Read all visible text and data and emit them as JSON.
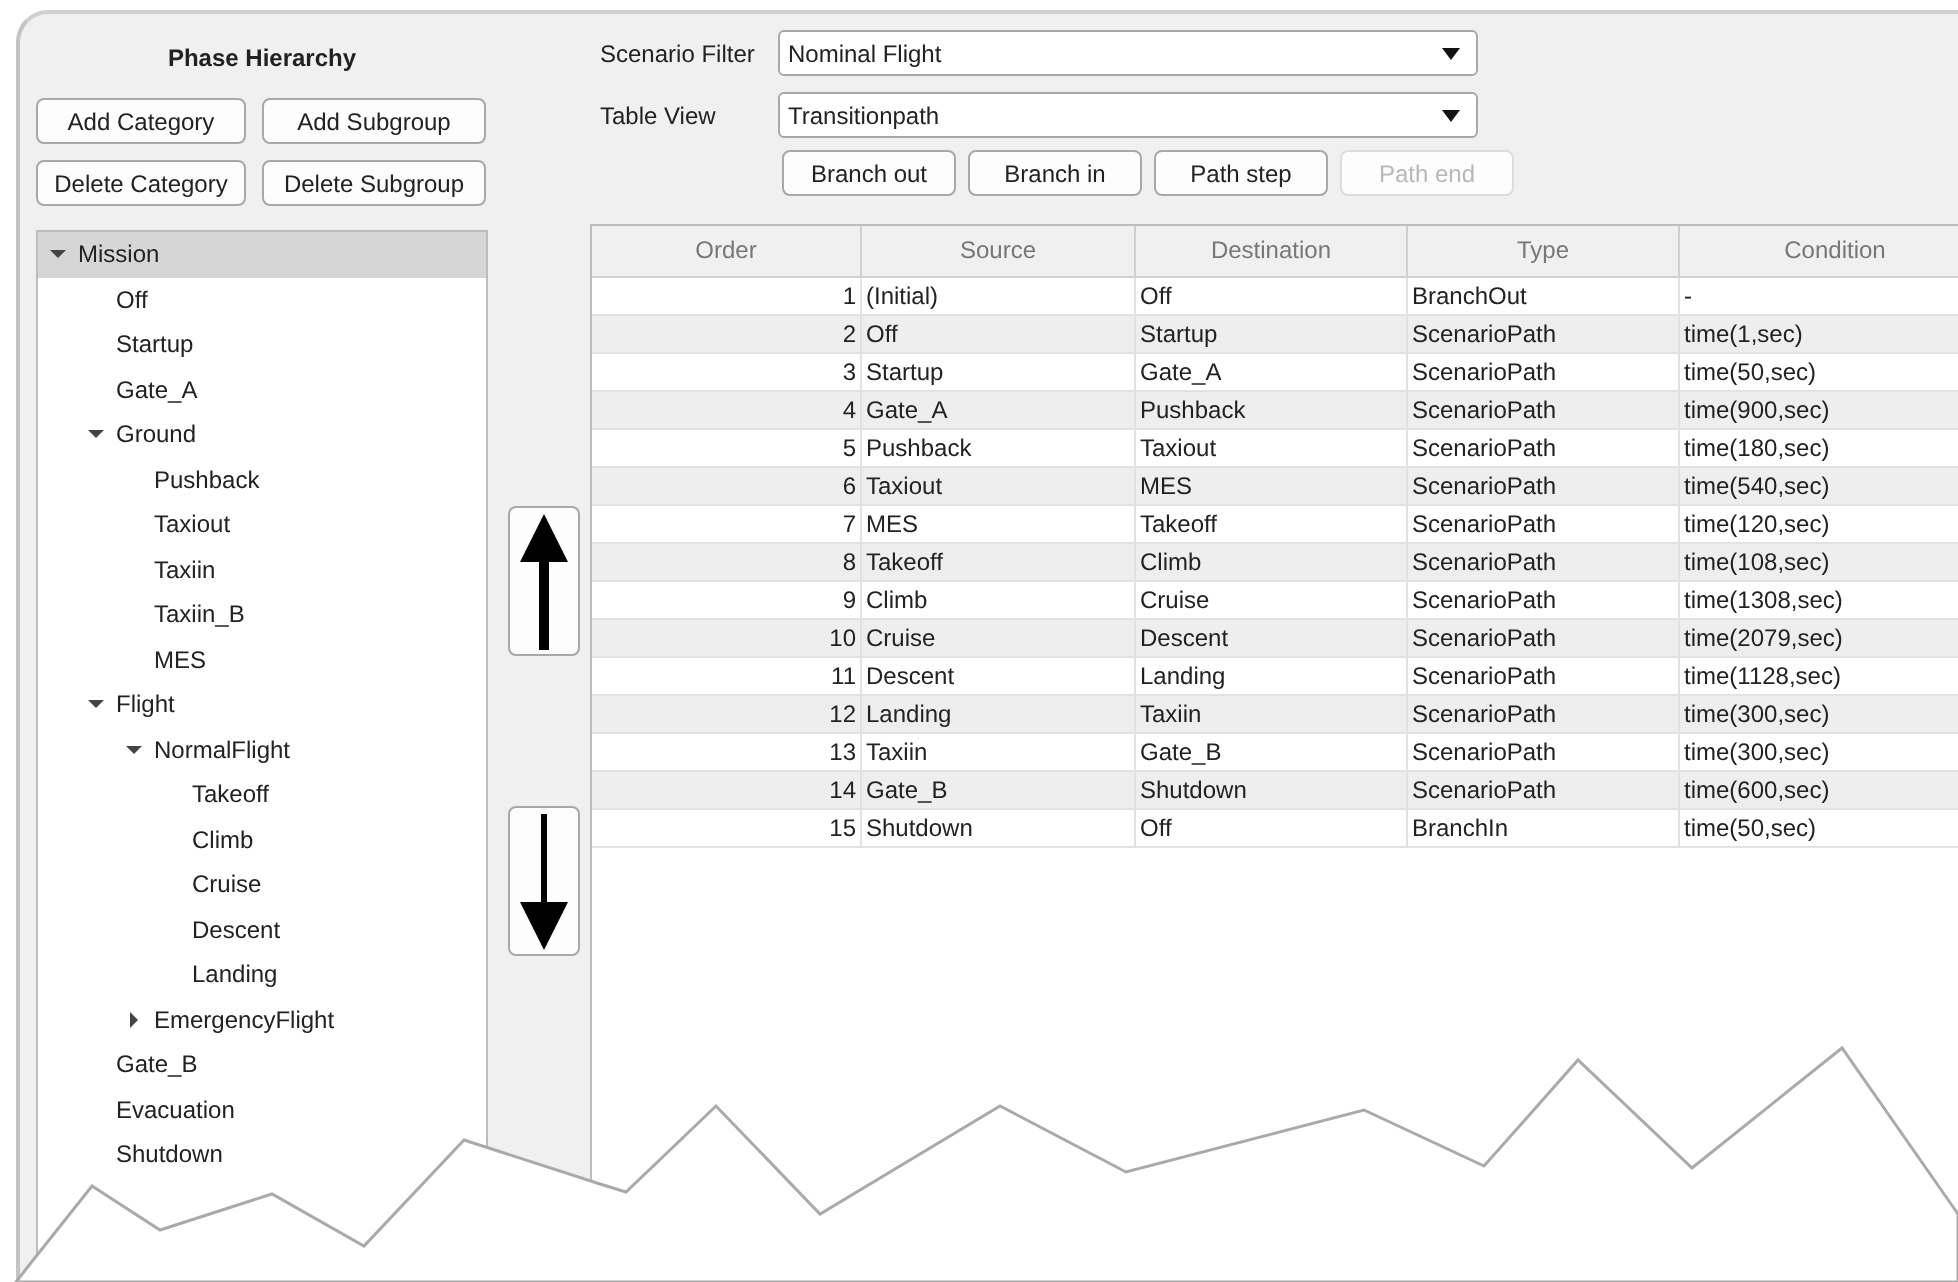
{
  "hierarchy": {
    "title": "Phase Hierarchy",
    "buttons": [
      {
        "label": "Add Category"
      },
      {
        "label": "Add Subgroup"
      },
      {
        "label": "Delete Category"
      },
      {
        "label": "Delete Subgroup"
      }
    ],
    "tree": [
      {
        "label": "Mission",
        "selected": true,
        "expanded": true,
        "children": [
          {
            "label": "Off",
            "selected": false
          },
          {
            "label": "Startup",
            "selected": false
          },
          {
            "label": "Gate_A",
            "selected": false
          },
          {
            "label": "Ground",
            "selected": false,
            "expanded": true,
            "children": [
              {
                "label": "Pushback",
                "selected": false
              },
              {
                "label": "Taxiout",
                "selected": false
              },
              {
                "label": "Taxiin",
                "selected": false
              },
              {
                "label": "Taxiin_B",
                "selected": false
              },
              {
                "label": "MES",
                "selected": false
              }
            ]
          },
          {
            "label": "Flight",
            "selected": false,
            "expanded": true,
            "children": [
              {
                "label": "NormalFlight",
                "selected": false,
                "expanded": true,
                "children": [
                  {
                    "label": "Takeoff",
                    "selected": false
                  },
                  {
                    "label": "Climb",
                    "selected": false
                  },
                  {
                    "label": "Cruise",
                    "selected": false
                  },
                  {
                    "label": "Descent",
                    "selected": false
                  },
                  {
                    "label": "Landing",
                    "selected": false
                  }
                ]
              },
              {
                "label": "EmergencyFlight",
                "selected": false,
                "expanded": false
              }
            ]
          },
          {
            "label": "Gate_B",
            "selected": false
          },
          {
            "label": "Evacuation",
            "selected": false
          },
          {
            "label": "Shutdown",
            "selected": false
          }
        ]
      }
    ]
  },
  "scenario_filter": {
    "label": "Scenario Filter",
    "value": "Nominal Flight"
  },
  "table_view": {
    "label": "Table View",
    "value": "Transitionpath"
  },
  "path_buttons": [
    {
      "label": "Branch out",
      "disabled": false
    },
    {
      "label": "Branch in",
      "disabled": false
    },
    {
      "label": "Path step",
      "disabled": false
    },
    {
      "label": "Path end",
      "disabled": true
    }
  ],
  "table": {
    "columns": [
      "Order",
      "Source",
      "Destination",
      "Type",
      "Condition"
    ],
    "rows": [
      [
        "1",
        "(Initial)",
        "Off",
        "BranchOut",
        "-"
      ],
      [
        "2",
        "Off",
        "Startup",
        "ScenarioPath",
        "time(1,sec)"
      ],
      [
        "3",
        "Startup",
        "Gate_A",
        "ScenarioPath",
        "time(50,sec)"
      ],
      [
        "4",
        "Gate_A",
        "Pushback",
        "ScenarioPath",
        "time(900,sec)"
      ],
      [
        "5",
        "Pushback",
        "Taxiout",
        "ScenarioPath",
        "time(180,sec)"
      ],
      [
        "6",
        "Taxiout",
        "MES",
        "ScenarioPath",
        "time(540,sec)"
      ],
      [
        "7",
        "MES",
        "Takeoff",
        "ScenarioPath",
        "time(120,sec)"
      ],
      [
        "8",
        "Takeoff",
        "Climb",
        "ScenarioPath",
        "time(108,sec)"
      ],
      [
        "9",
        "Climb",
        "Cruise",
        "ScenarioPath",
        "time(1308,sec)"
      ],
      [
        "10",
        "Cruise",
        "Descent",
        "ScenarioPath",
        "time(2079,sec)"
      ],
      [
        "11",
        "Descent",
        "Landing",
        "ScenarioPath",
        "time(1128,sec)"
      ],
      [
        "12",
        "Landing",
        "Taxiin",
        "ScenarioPath",
        "time(300,sec)"
      ],
      [
        "13",
        "Taxiin",
        "Gate_B",
        "ScenarioPath",
        "time(300,sec)"
      ],
      [
        "14",
        "Gate_B",
        "Shutdown",
        "ScenarioPath",
        "time(600,sec)"
      ],
      [
        "15",
        "Shutdown",
        "Off",
        "BranchIn",
        "time(50,sec)"
      ]
    ]
  }
}
